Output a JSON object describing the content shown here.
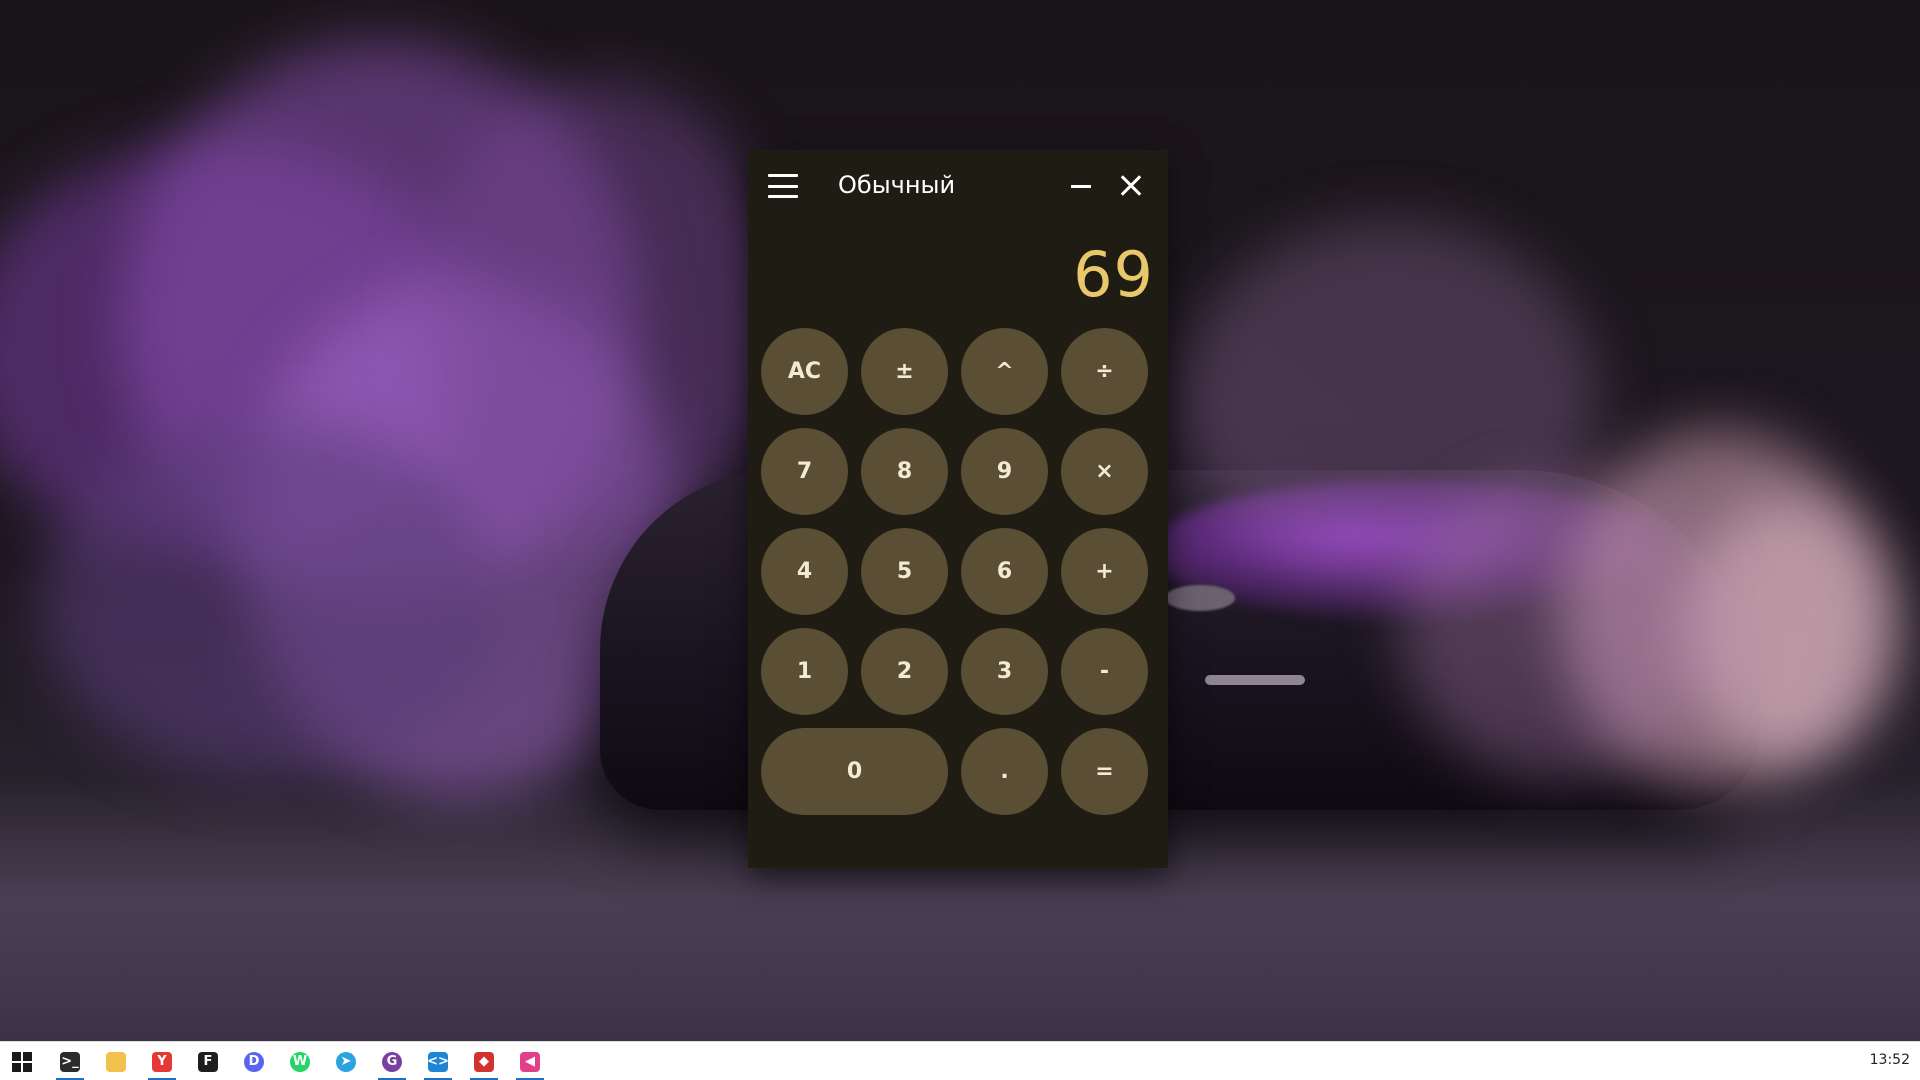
{
  "window": {
    "title": "Обычный",
    "display_value": "69"
  },
  "keypad": [
    {
      "label": "AC",
      "name": "clear-button",
      "wide": false
    },
    {
      "label": "±",
      "name": "negate-button",
      "wide": false
    },
    {
      "label": "^",
      "name": "power-button",
      "wide": false
    },
    {
      "label": "÷",
      "name": "divide-button",
      "wide": false
    },
    {
      "label": "7",
      "name": "digit-7-button",
      "wide": false
    },
    {
      "label": "8",
      "name": "digit-8-button",
      "wide": false
    },
    {
      "label": "9",
      "name": "digit-9-button",
      "wide": false
    },
    {
      "label": "×",
      "name": "multiply-button",
      "wide": false
    },
    {
      "label": "4",
      "name": "digit-4-button",
      "wide": false
    },
    {
      "label": "5",
      "name": "digit-5-button",
      "wide": false
    },
    {
      "label": "6",
      "name": "digit-6-button",
      "wide": false
    },
    {
      "label": "+",
      "name": "add-button",
      "wide": false
    },
    {
      "label": "1",
      "name": "digit-1-button",
      "wide": false
    },
    {
      "label": "2",
      "name": "digit-2-button",
      "wide": false
    },
    {
      "label": "3",
      "name": "digit-3-button",
      "wide": false
    },
    {
      "label": "-",
      "name": "subtract-button",
      "wide": false
    },
    {
      "label": "0",
      "name": "digit-0-button",
      "wide": true
    },
    {
      "label": ".",
      "name": "decimal-button",
      "wide": false
    },
    {
      "label": "=",
      "name": "equals-button",
      "wide": false
    }
  ],
  "colors": {
    "window_bg": "#1f1c13",
    "key_bg": "#5a4e34",
    "key_text": "#f4ead4",
    "display_text": "#e8c86a",
    "taskbar_bg": "#ffffff",
    "taskbar_indicator": "#1a6fc7"
  },
  "taskbar": {
    "clock": "13:52",
    "apps": [
      {
        "name": "start-button",
        "icon": "windows-logo-icon",
        "glyph": "",
        "color": "#1a1a1a",
        "active": false
      },
      {
        "name": "taskbar-terminal",
        "icon": "terminal-icon",
        "glyph": ">_",
        "color": "#2b2b2b",
        "active": true
      },
      {
        "name": "taskbar-file-explorer",
        "icon": "folder-icon",
        "glyph": "",
        "color": "#f2c14e",
        "active": false
      },
      {
        "name": "taskbar-yandex-browser",
        "icon": "yandex-browser-icon",
        "glyph": "Y",
        "color": "#e53935",
        "active": true
      },
      {
        "name": "taskbar-figma",
        "icon": "figma-icon",
        "glyph": "F",
        "color": "#1e1e1e",
        "active": false
      },
      {
        "name": "taskbar-discord",
        "icon": "discord-icon",
        "glyph": "D",
        "color": "#5865f2",
        "active": false
      },
      {
        "name": "taskbar-whatsapp",
        "icon": "whatsapp-icon",
        "glyph": "W",
        "color": "#25d366",
        "active": false
      },
      {
        "name": "taskbar-telegram",
        "icon": "telegram-icon",
        "glyph": "➤",
        "color": "#2aa3e0",
        "active": false
      },
      {
        "name": "taskbar-github-desktop",
        "icon": "github-desktop-icon",
        "glyph": "G",
        "color": "#7b3fa0",
        "active": true
      },
      {
        "name": "taskbar-vscode",
        "icon": "vscode-icon",
        "glyph": "<>",
        "color": "#1f86d6",
        "active": true
      },
      {
        "name": "taskbar-app-red",
        "icon": "app-icon",
        "glyph": "◆",
        "color": "#d2332f",
        "active": true
      },
      {
        "name": "taskbar-app-pink",
        "icon": "app-icon",
        "glyph": "◀",
        "color": "#e0408a",
        "active": true
      }
    ]
  }
}
